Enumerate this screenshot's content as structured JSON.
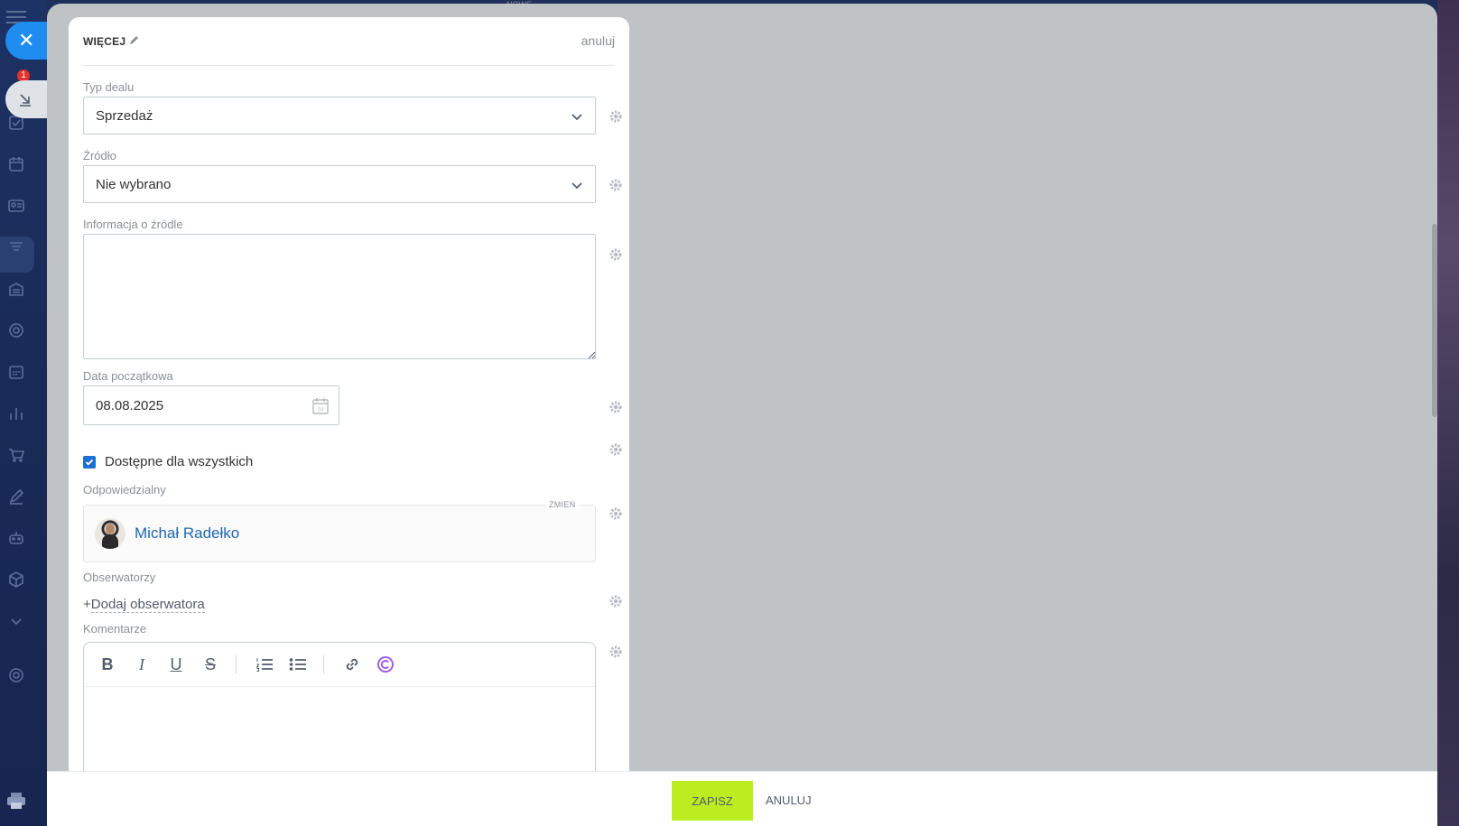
{
  "background_hint": "NOWE",
  "rail": {
    "badge_count": "1"
  },
  "card": {
    "section_title": "WIĘCEJ",
    "cancel_link": "anuluj",
    "deal_type": {
      "label": "Typ dealu",
      "value": "Sprzedaż"
    },
    "source": {
      "label": "Źródło",
      "value": "Nie wybrano"
    },
    "source_info": {
      "label": "Informacja o źródle",
      "value": ""
    },
    "start_date": {
      "label": "Data początkowa",
      "value": "08.08.2025",
      "calendar_day": "24"
    },
    "available_to_all": {
      "label": "Dostępne dla wszystkich",
      "checked": true
    },
    "responsible": {
      "label": "Odpowiedzialny",
      "change_link": "ZMIEŃ",
      "name": "Michał Radełko"
    },
    "watchers": {
      "label": "Obserwatorzy",
      "add_plus": "+",
      "add_label": "Dodaj obserwatora"
    },
    "comments": {
      "label": "Komentarze"
    }
  },
  "footer": {
    "save_label": "ZAPISZ",
    "cancel_label": "ANULUJ"
  },
  "colors": {
    "accent_blue": "#1f8cf0",
    "save_green": "#bbed21",
    "link_blue": "#2067b0",
    "checkbox_blue": "#1f6fd1",
    "copilot_purple": "#a15de8"
  }
}
